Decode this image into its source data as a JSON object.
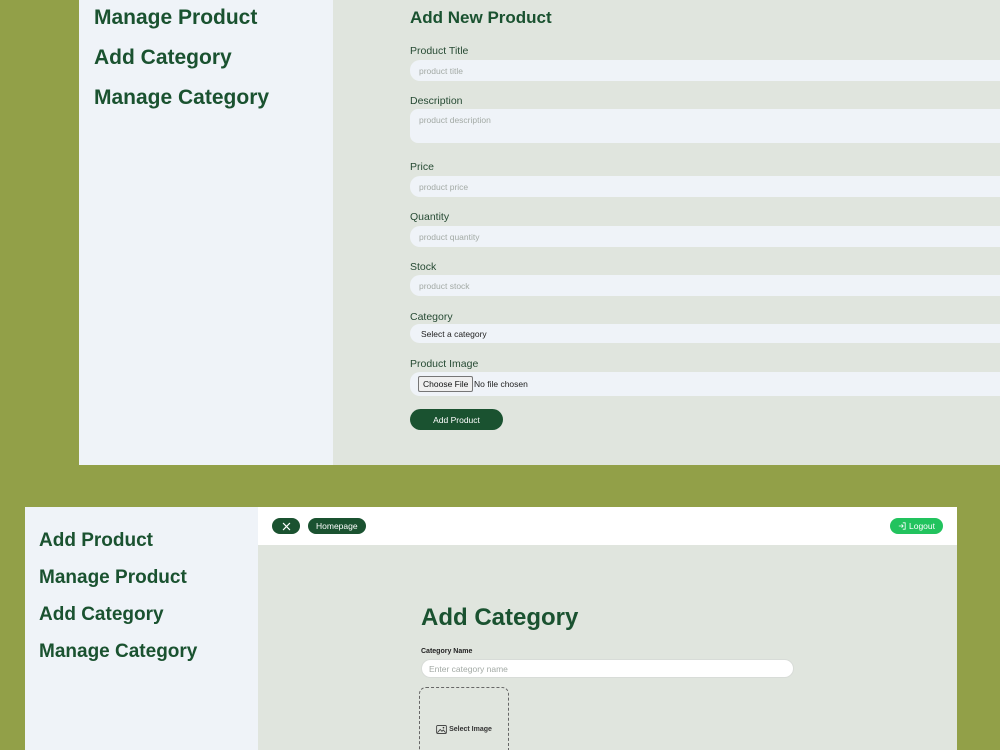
{
  "top": {
    "sidebar": {
      "items": [
        {
          "label": "Manage Product"
        },
        {
          "label": "Add Category"
        },
        {
          "label": "Manage Category"
        }
      ]
    },
    "form": {
      "title": "Add New Product",
      "fields": {
        "title": {
          "label": "Product Title",
          "placeholder": "product title"
        },
        "description": {
          "label": "Description",
          "placeholder": "product description"
        },
        "price": {
          "label": "Price",
          "placeholder": "product price"
        },
        "quantity": {
          "label": "Quantity",
          "placeholder": "product quantity"
        },
        "stock": {
          "label": "Stock",
          "placeholder": "product stock"
        },
        "category": {
          "label": "Category",
          "selected": "Select a category"
        },
        "image": {
          "label": "Product Image",
          "button": "Choose File",
          "status": "No file chosen"
        }
      },
      "submit_label": "Add Product"
    }
  },
  "bottom": {
    "sidebar": {
      "items": [
        {
          "label": "Add Product"
        },
        {
          "label": "Manage Product"
        },
        {
          "label": "Add Category"
        },
        {
          "label": "Manage Category"
        }
      ]
    },
    "topbar": {
      "close_icon": "close-icon",
      "homepage_label": "Homepage",
      "logout_label": "Logout",
      "logout_icon": "logout-icon"
    },
    "form": {
      "title": "Add Category",
      "name_label": "Category Name",
      "name_placeholder": "Enter category name",
      "image_label": "Select Image",
      "image_icon": "image-icon"
    }
  },
  "colors": {
    "background": "#92a048",
    "sidebar": "#eff3f8",
    "main": "#e0e5de",
    "brand_dark_green": "#1a5230",
    "logout_green": "#22c35e"
  }
}
